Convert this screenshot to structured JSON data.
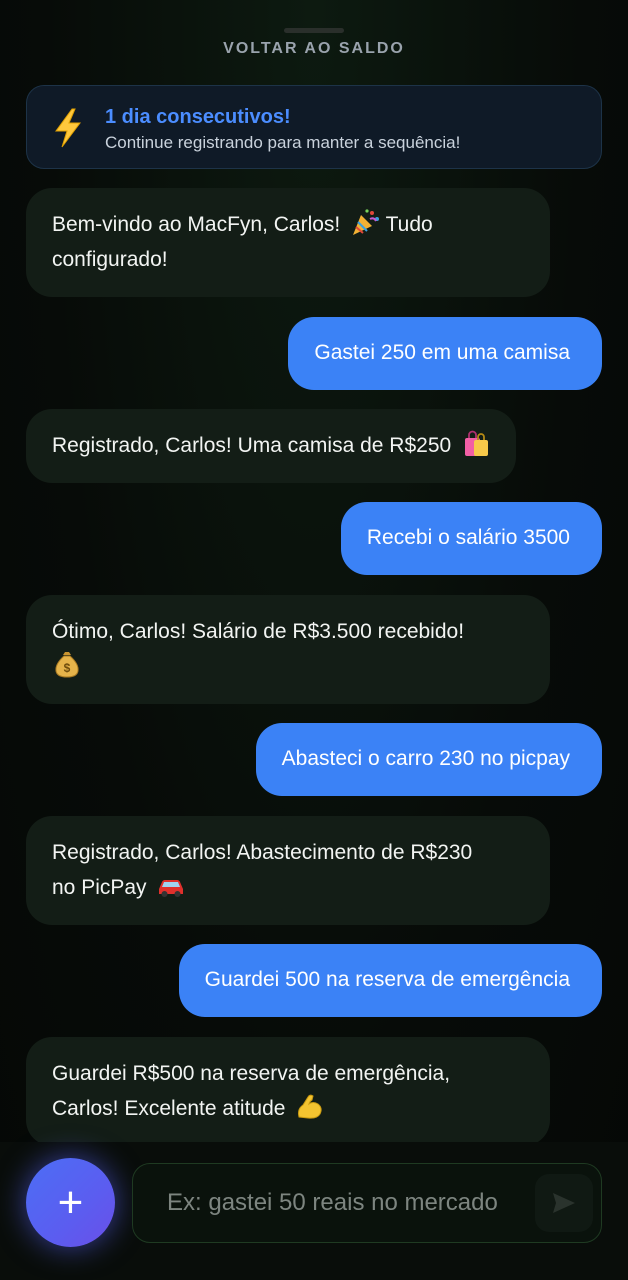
{
  "header": {
    "back_label": "VOLTAR AO SALDO"
  },
  "streak": {
    "title": "1 dia consecutivos!",
    "subtitle": "Continue registrando para manter a sequência!",
    "icon": "lightning-icon"
  },
  "messages": [
    {
      "role": "bot",
      "line1": "Bem-vindo ao MacFyn, Carlos!",
      "line1_after": "Tudo",
      "line2": "configurado!",
      "emoji": "party-popper-icon"
    },
    {
      "role": "user",
      "text": "Gastei 250 em uma camisa"
    },
    {
      "role": "bot",
      "text": "Registrado, Carlos! Uma camisa de R$250",
      "emoji": "shopping-bags-icon"
    },
    {
      "role": "user",
      "text": "Recebi o salário 3500"
    },
    {
      "role": "bot",
      "text": "Ótimo, Carlos! Salário de R$3.500 recebido!",
      "emoji": "money-bag-icon"
    },
    {
      "role": "user",
      "text": "Abasteci o carro 230 no picpay"
    },
    {
      "role": "bot",
      "line1": "Registrado, Carlos! Abastecimento de R$230",
      "line2": "no PicPay",
      "emoji": "car-icon"
    },
    {
      "role": "user",
      "text": "Guardei 500 na reserva de emergência"
    },
    {
      "role": "bot",
      "line1": "Guardei R$500 na reserva de emergência,",
      "line2": "Carlos! Excelente atitude",
      "emoji": "flexed-biceps-icon"
    }
  ],
  "composer": {
    "placeholder": "Ex: gastei 50 reais no mercado",
    "add_icon": "plus-icon",
    "send_icon": "send-icon"
  },
  "colors": {
    "accent": "#3b82f6",
    "streak_title": "#4b8dff",
    "bot_bubble": "#131d16"
  }
}
